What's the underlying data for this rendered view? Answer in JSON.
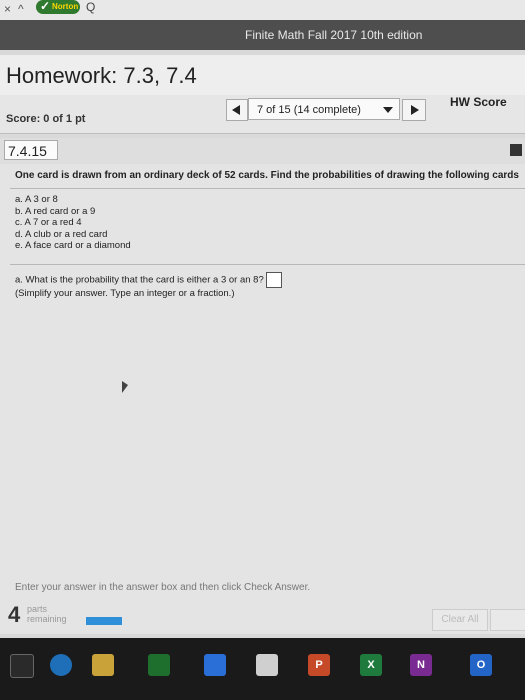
{
  "browser": {
    "close_glyph": "×",
    "caret_glyph": "^",
    "search_glyph": "Q",
    "extension": "Norton"
  },
  "course": {
    "title": "Finite Math Fall 2017 10th edition"
  },
  "homework": {
    "title": "Homework: 7.3, 7.4"
  },
  "score": {
    "label": "Score: 0 of 1 pt"
  },
  "nav": {
    "counter": "7 of 15 (14 complete)",
    "hw_score_label": "HW Score"
  },
  "question": {
    "number": "7.4.15",
    "prompt": "One card is drawn from an ordinary deck of 52 cards. Find the probabilities of drawing the following cards",
    "parts": [
      "a. A 3 or 8",
      "b. A red card or a 9",
      "c. A 7 or a red 4",
      "d. A club or a red card",
      "e. A face card or a diamond"
    ],
    "current_part": "a. What is the probability that the card is either a 3 or an 8?",
    "hint": "(Simplify your answer. Type an integer or a fraction.)",
    "answer_value": ""
  },
  "footer": {
    "instruction": "Enter your answer in the answer box and then click Check Answer.",
    "parts_count": "4",
    "parts_label": "parts",
    "remaining_label": "remaining",
    "progress": 0.1,
    "clear_all": "Clear All"
  },
  "taskbar": {
    "icons": [
      "windows-icon",
      "edge-icon",
      "file-explorer-icon",
      "store-icon",
      "dropbox-icon",
      "onedrive-icon",
      "powerpoint-icon",
      "excel-icon",
      "onenote-icon",
      "outlook-icon"
    ],
    "letters": {
      "ppt": "P",
      "excel": "X",
      "onenote": "N",
      "outlook": "O"
    }
  },
  "colors": {
    "course_bar": "#4e4e4e",
    "progress": "#2f8fd8",
    "norton_green": "#2f7a2f"
  }
}
